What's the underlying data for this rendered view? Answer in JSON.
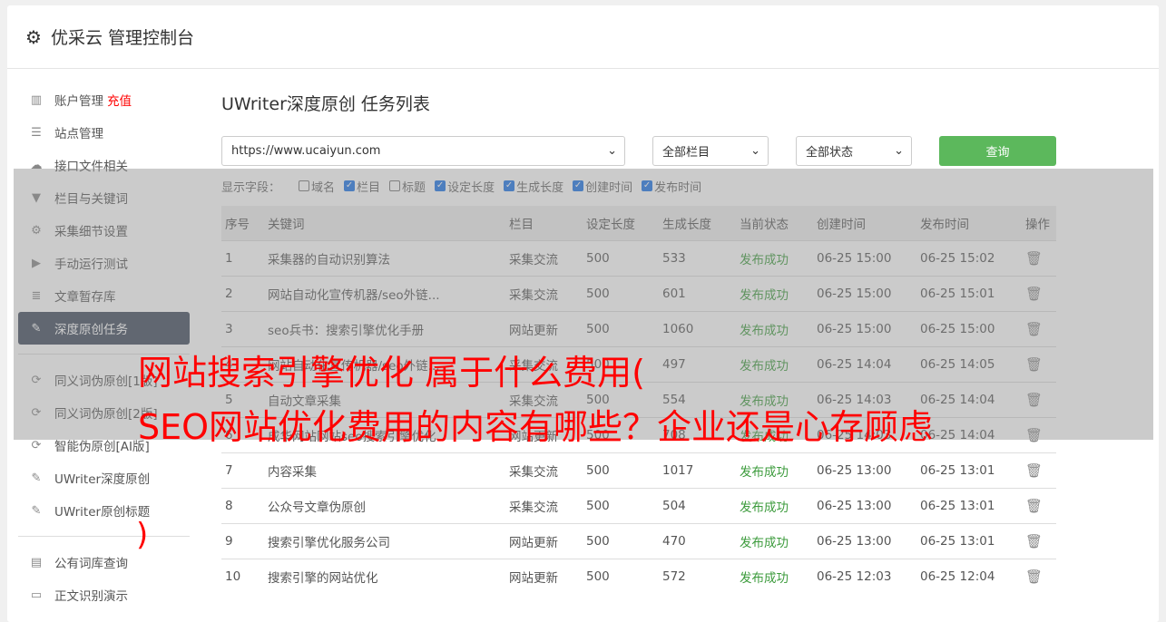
{
  "header": {
    "title": "优采云 管理控制台"
  },
  "sidebar": {
    "items": [
      {
        "label": "账户管理",
        "extra": "充值",
        "icon": "bar-chart-icon"
      },
      {
        "label": "站点管理",
        "icon": "server-icon"
      },
      {
        "label": "接口文件相关",
        "icon": "cloud-upload-icon"
      },
      {
        "label": "栏目与关键词",
        "icon": "filter-icon"
      },
      {
        "label": "采集细节设置",
        "icon": "gears-icon"
      },
      {
        "label": "手动运行测试",
        "icon": "play-icon"
      },
      {
        "label": "文章暂存库",
        "icon": "database-icon"
      },
      {
        "label": "深度原创任务",
        "icon": "edit-icon"
      }
    ],
    "items2": [
      {
        "label": "同义词伪原创[1版]",
        "icon": "refresh-icon"
      },
      {
        "label": "同义词伪原创[2版]",
        "icon": "refresh-icon"
      },
      {
        "label": "智能伪原创[AI版]",
        "icon": "refresh-icon"
      },
      {
        "label": "UWriter深度原创",
        "icon": "edit-icon"
      },
      {
        "label": "UWriter原创标题",
        "icon": "edit-icon"
      }
    ],
    "items3": [
      {
        "label": "公有词库查询",
        "icon": "book-icon"
      },
      {
        "label": "正文识别演示",
        "icon": "monitor-icon"
      }
    ]
  },
  "main": {
    "title": "UWriter深度原创 任务列表",
    "site_select": "https://www.ucaiyun.com",
    "column_select": "全部栏目",
    "status_select": "全部状态",
    "query_label": "查询",
    "fields_label": "显示字段：",
    "fields": [
      {
        "label": "域名",
        "checked": false
      },
      {
        "label": "栏目",
        "checked": true
      },
      {
        "label": "标题",
        "checked": false
      },
      {
        "label": "设定长度",
        "checked": true
      },
      {
        "label": "生成长度",
        "checked": true
      },
      {
        "label": "创建时间",
        "checked": true
      },
      {
        "label": "发布时间",
        "checked": true
      }
    ],
    "columns": [
      "序号",
      "关键词",
      "栏目",
      "设定长度",
      "生成长度",
      "当前状态",
      "创建时间",
      "发布时间",
      "操作"
    ],
    "rows": [
      [
        "1",
        "采集器的自动识别算法",
        "采集交流",
        "500",
        "533",
        "发布成功",
        "06-25 15:00",
        "06-25 15:02"
      ],
      [
        "2",
        "网站自动化宣传机器/seo外链...",
        "采集交流",
        "500",
        "601",
        "发布成功",
        "06-25 15:00",
        "06-25 15:01"
      ],
      [
        "3",
        "seo兵书：搜索引擎优化手册",
        "网站更新",
        "500",
        "1060",
        "发布成功",
        "06-25 15:00",
        "06-25 15:00"
      ],
      [
        "4",
        "网站自动化宣传机器/seo外链...",
        "采集交流",
        "500",
        "497",
        "发布成功",
        "06-25 14:04",
        "06-25 14:05"
      ],
      [
        "5",
        "自动文章采集",
        "采集交流",
        "500",
        "554",
        "发布成功",
        "06-25 14:03",
        "06-25 14:04"
      ],
      [
        "6",
        "成华网站网站seo搜索引擎优化",
        "网站更新",
        "500",
        "708",
        "发布成功",
        "06-25 14:03",
        "06-25 14:04"
      ],
      [
        "7",
        "内容采集",
        "采集交流",
        "500",
        "1017",
        "发布成功",
        "06-25 13:00",
        "06-25 13:01"
      ],
      [
        "8",
        "公众号文章伪原创",
        "采集交流",
        "500",
        "504",
        "发布成功",
        "06-25 13:00",
        "06-25 13:01"
      ],
      [
        "9",
        "搜索引擎优化服务公司",
        "网站更新",
        "500",
        "470",
        "发布成功",
        "06-25 13:00",
        "06-25 13:01"
      ],
      [
        "10",
        "搜索引擎的网站优化",
        "网站更新",
        "500",
        "572",
        "发布成功",
        "06-25 12:03",
        "06-25 12:04"
      ]
    ]
  },
  "overlay": {
    "line1": "网站搜索引擎优化 属于什么费用(",
    "line2": "SEO网站优化费用的内容有哪些？企业还是心存顾虑",
    "line3": ")"
  }
}
